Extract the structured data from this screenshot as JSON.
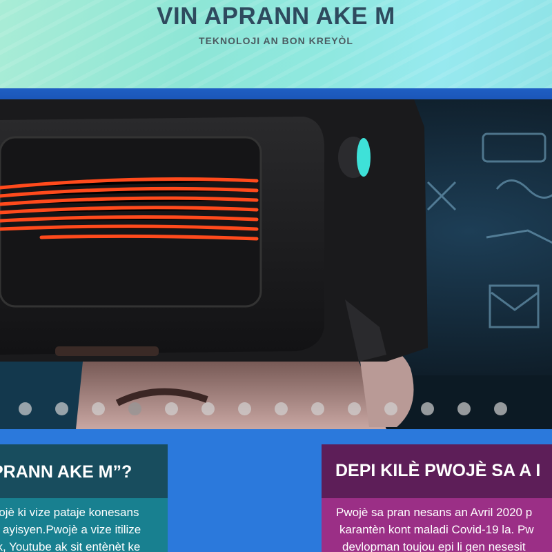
{
  "header": {
    "title": "VIN APRANN AKE M",
    "tagline": "TEKNOLOJI AN BON KREYÒL"
  },
  "slider": {
    "image": "person-wearing-vr-headset",
    "dot_count": 14,
    "active_index": 3
  },
  "cards": [
    {
      "title": "PRANN AKE M”?",
      "lines": [
        "wojè ki vize pataje konesans",
        "ol ayisyen.Pwojè a vize itilize",
        "ok, Youtube ak sit entènèt ke"
      ],
      "colors": {
        "header": "#184d5e",
        "body": "#188090"
      }
    },
    {
      "title": "DEPI KILÈ PWOJÈ SA A I",
      "lines": [
        "Pwojè sa pran nesans an Avril 2020 p",
        "karantèn kont maladi Covid-19 la. Pw",
        "devlopman toujou epi li gen nesesit"
      ],
      "colors": {
        "header": "#5d1e58",
        "body": "#9b2f86"
      }
    }
  ],
  "colors": {
    "page_background": "#2a76d8",
    "header_gradient": "#8ee6d6",
    "title_text": "#2e4a5e"
  }
}
